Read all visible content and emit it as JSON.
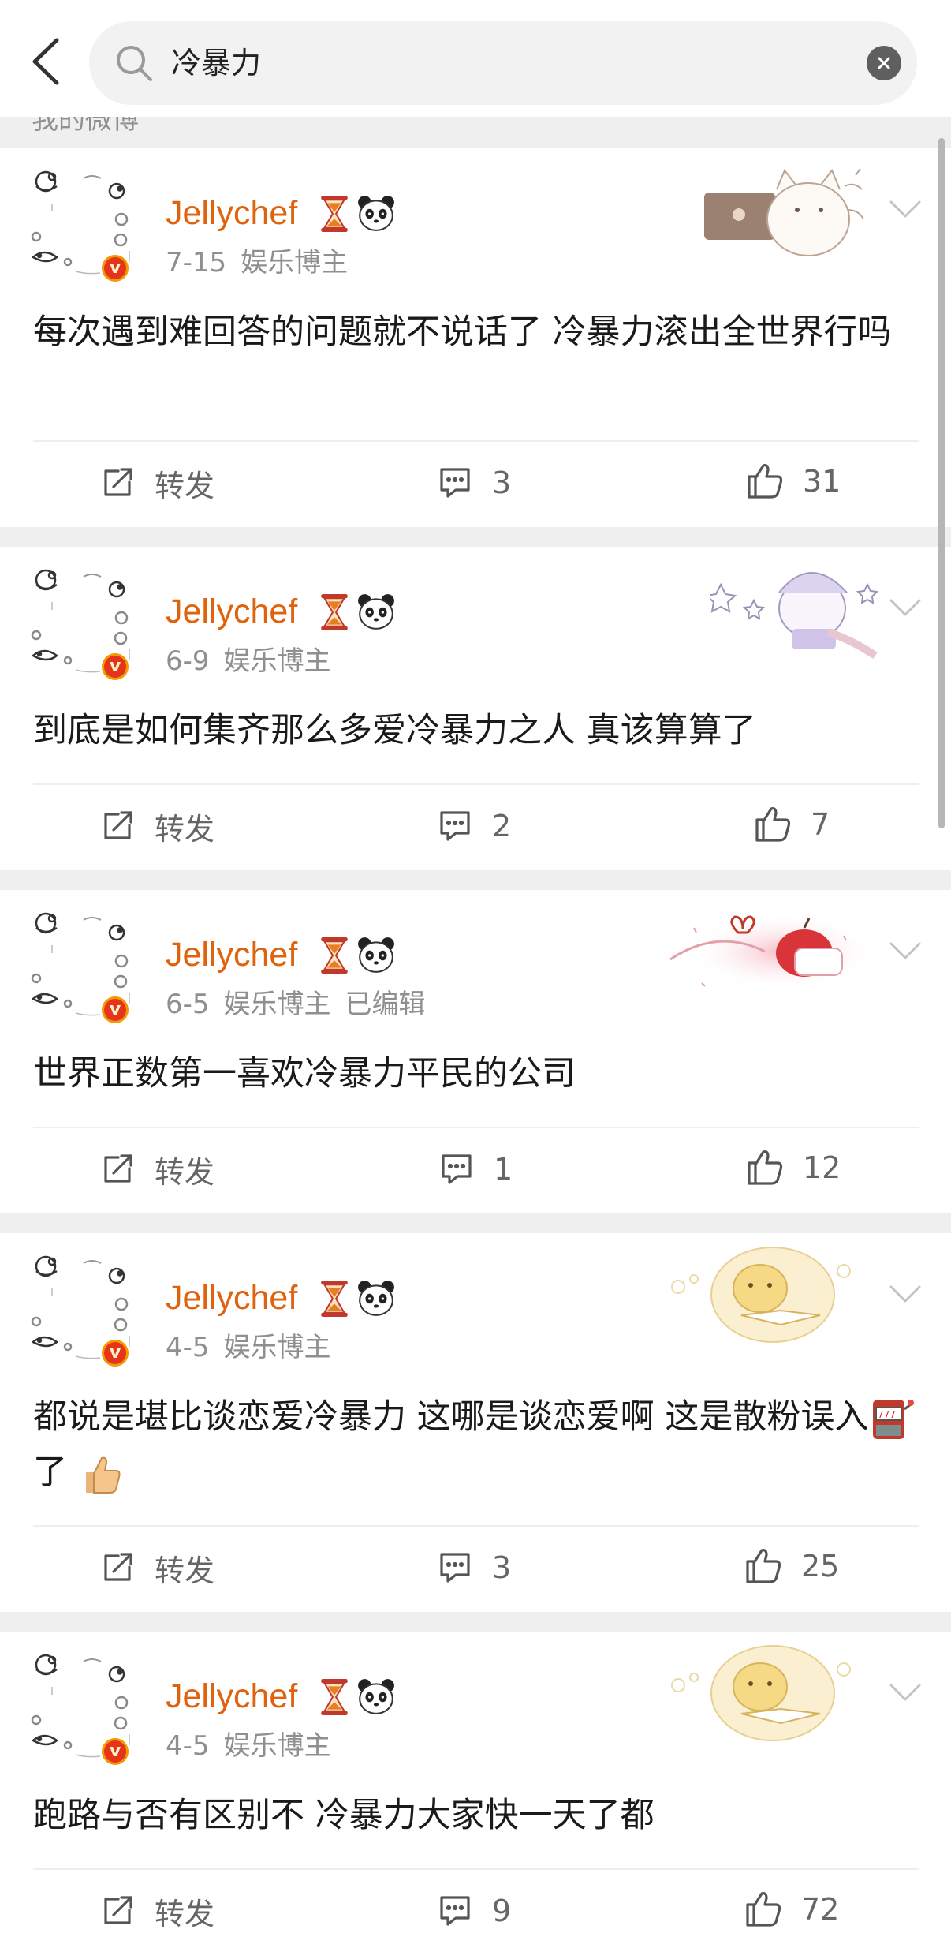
{
  "search": {
    "query": "冷暴力"
  },
  "section": {
    "peek_label": "我的微博"
  },
  "colors": {
    "username": "#e0620c",
    "meta": "#8f8f8f",
    "badge": "#f39a00"
  },
  "posts": [
    {
      "username": "Jellychef",
      "date": "7-15",
      "tag": "娱乐博主",
      "edited": "",
      "text": "每次遇到难回答的问题就不说话了 冷暴力滚出全世界行吗",
      "repost_label": "转发",
      "comments": "3",
      "likes": "31",
      "deco": "cat-laptop"
    },
    {
      "username": "Jellychef",
      "date": "6-9",
      "tag": "娱乐博主",
      "edited": "",
      "text": "到底是如何集齐那么多爱冷暴力之人 真该算算了",
      "repost_label": "转发",
      "comments": "2",
      "likes": "7",
      "deco": "sleepy-cat-stars"
    },
    {
      "username": "Jellychef",
      "date": "6-5",
      "tag": "娱乐博主",
      "edited": "已编辑",
      "text": "世界正数第一喜欢冷暴力平民的公司",
      "repost_label": "转发",
      "comments": "1",
      "likes": "12",
      "deco": "apple-cup"
    },
    {
      "username": "Jellychef",
      "date": "4-5",
      "tag": "娱乐博主",
      "edited": "",
      "text_part1": "都说是堪比谈恋爱冷暴力 这哪是谈恋爱啊 这是散粉误入",
      "text_part2": "了",
      "repost_label": "转发",
      "comments": "3",
      "likes": "25",
      "deco": "bear-reading"
    },
    {
      "username": "Jellychef",
      "date": "4-5",
      "tag": "娱乐博主",
      "edited": "",
      "text": "跑路与否有区别不 冷暴力大家快一天了都",
      "repost_label": "转发",
      "comments": "9",
      "likes": "72",
      "deco": "bear-reading"
    }
  ]
}
